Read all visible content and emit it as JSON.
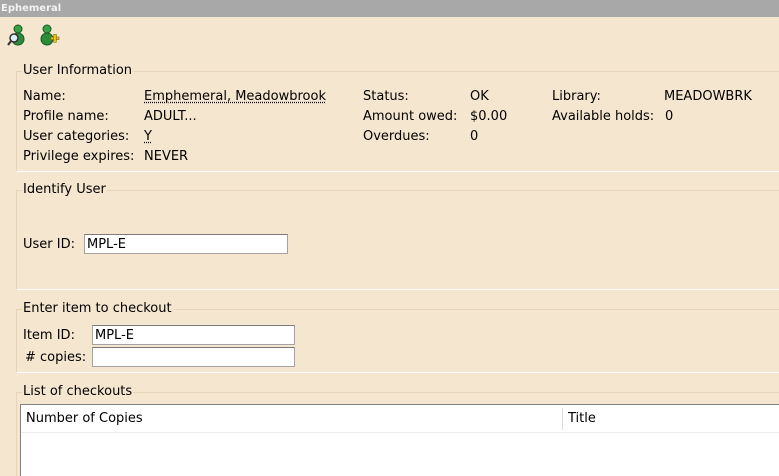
{
  "window": {
    "title": "Ephemeral"
  },
  "toolbar": {
    "buttons": [
      {
        "icon": "user-search-icon"
      },
      {
        "icon": "user-add-icon"
      }
    ]
  },
  "user_info": {
    "title": "User Information",
    "name_label": "Name:",
    "name_value": "Emphemeral, Meadowbrook",
    "profile_label": "Profile name:",
    "profile_value": "ADULT...",
    "categories_label": "User categories:",
    "categories_value": "Y",
    "privilege_label": "Privilege expires:",
    "privilege_value": "NEVER",
    "status_label": "Status:",
    "status_value": "OK",
    "owed_label": "Amount owed:",
    "owed_value": "$0.00",
    "overdues_label": "Overdues:",
    "overdues_value": "0",
    "library_label": "Library:",
    "library_value": "MEADOWBRK",
    "holds_label": "Available holds:",
    "holds_value": "0"
  },
  "identify_user": {
    "title": "Identify User",
    "user_id_label": "User ID:",
    "user_id_value": "MPL-E"
  },
  "checkout": {
    "title": "Enter item to checkout",
    "item_id_label": "Item ID:",
    "item_id_value": "MPL-E",
    "copies_label": "# copies:",
    "copies_value": ""
  },
  "checkouts_list": {
    "title": "List of checkouts",
    "columns": [
      "Number of Copies",
      "Title"
    ]
  },
  "colors": {
    "panel_bg": "#f5e6cf",
    "titlebar_bg": "#a8a8a8",
    "input_border": "#a3a3a3"
  }
}
